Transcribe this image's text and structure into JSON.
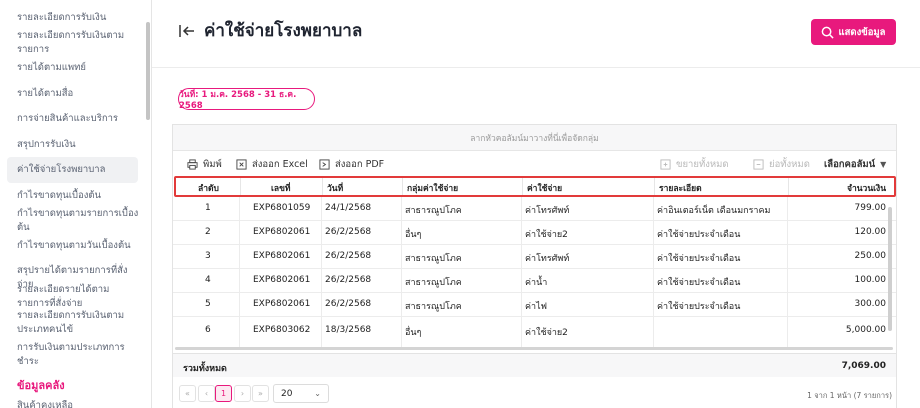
{
  "sidebar": {
    "items": [
      {
        "label": "รายละเอียดการรับเงิน"
      },
      {
        "label": "รายละเอียดการรับเงินตามรายการ"
      },
      {
        "label": "รายได้ตามแพทย์"
      },
      {
        "label": "รายได้ตามสื่อ"
      },
      {
        "label": "การจ่ายสินค้าและบริการ"
      },
      {
        "label": "สรุปการรับเงิน"
      },
      {
        "label": "ค่าใช้จ่ายโรงพยาบาล"
      },
      {
        "label": "กำไรขาดทุนเบื้องต้น"
      },
      {
        "label": "กำไรขาดทุนตามรายการเบื้องต้น"
      },
      {
        "label": "กำไรขาดทุนตามวันเบื้องต้น"
      },
      {
        "label": "สรุปรายได้ตามรายการที่สั่งจ่าย"
      },
      {
        "label": "รายละเอียดรายได้ตามรายการที่สั่งจ่าย"
      },
      {
        "label": "รายละเอียดการรับเงินตามประเภทคนไข้"
      },
      {
        "label": "การรับเงินตามประเภทการชำระ"
      }
    ],
    "section_title": "ข้อมูลคลัง",
    "cut_item": "สินค้าคงเหลือ"
  },
  "header": {
    "title": "ค่าใช้จ่ายโรงพยาบาล",
    "show_button": "แสดงข้อมูล"
  },
  "date_badge": "วันที่: 1 ม.ค. 2568 - 31 ธ.ค. 2568",
  "table": {
    "group_hint": "ลากหัวคอลัมน์มาวางที่นี่เพื่อจัดกลุ่ม",
    "toolbar": {
      "print": "พิมพ์",
      "export_excel": "ส่งออก Excel",
      "export_pdf": "ส่งออก PDF",
      "expand_all": "ขยายทั้งหมด",
      "collapse_all": "ย่อทั้งหมด",
      "choose_columns": "เลือกคอลัมน์"
    },
    "columns": [
      "ลำดับ",
      "เลขที่",
      "วันที่",
      "กลุ่มค่าใช้จ่าย",
      "ค่าใช้จ่าย",
      "รายละเอียด",
      "จำนวนเงิน"
    ],
    "rows": [
      [
        "1",
        "EXP6801059",
        "24/1/2568",
        "สาธารณูปโภค",
        "ค่าโทรศัพท์",
        "ค่าอินเตอร์เน็ต เดือนมกราคม",
        "799.00"
      ],
      [
        "2",
        "EXP6802061",
        "26/2/2568",
        "อื่นๆ",
        "ค่าใช้จ่าย2",
        "ค่าใช้จ่ายประจำเดือน",
        "120.00"
      ],
      [
        "3",
        "EXP6802061",
        "26/2/2568",
        "สาธารณูปโภค",
        "ค่าโทรศัพท์",
        "ค่าใช้จ่ายประจำเดือน",
        "250.00"
      ],
      [
        "4",
        "EXP6802061",
        "26/2/2568",
        "สาธารณูปโภค",
        "ค่าน้ำ",
        "ค่าใช้จ่ายประจำเดือน",
        "100.00"
      ],
      [
        "5",
        "EXP6802061",
        "26/2/2568",
        "สาธารณูปโภค",
        "ค่าไฟ",
        "ค่าใช้จ่ายประจำเดือน",
        "300.00"
      ],
      [
        "6",
        "EXP6803062",
        "18/3/2568",
        "อื่นๆ",
        "ค่าใช้จ่าย2",
        "",
        "5,000.00"
      ]
    ],
    "summary": {
      "label": "รวมทั้งหมด",
      "total": "7,069.00"
    }
  },
  "pager": {
    "first": "«",
    "prev": "‹",
    "current_page": "1",
    "next": "›",
    "last": "»",
    "page_size": "20",
    "info": "1 จาก 1 หน้า (7 รายการ)"
  },
  "colors": {
    "accent": "#e8197d",
    "highlight_border": "#e23a3a"
  }
}
